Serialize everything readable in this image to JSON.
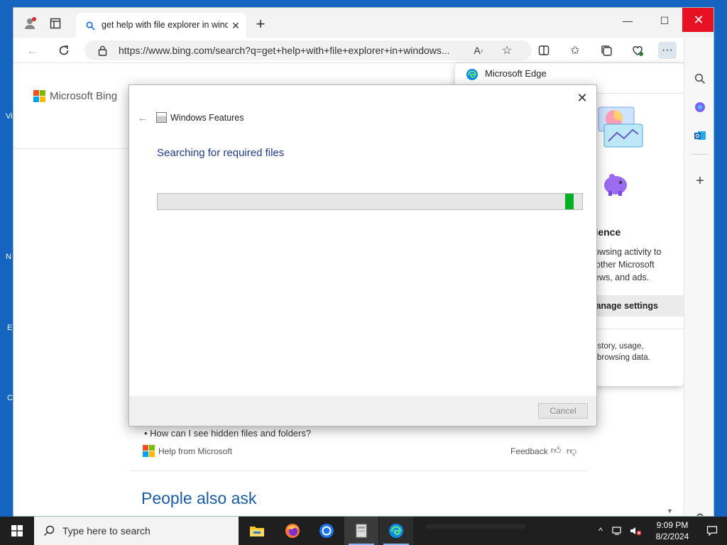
{
  "desktop": {
    "left_edge_labels": [
      "Vi",
      "N",
      "E",
      "C"
    ]
  },
  "browser": {
    "tab": {
      "title": "get help with file explorer in windows"
    },
    "address": {
      "url": "https://www.bing.com/search?q=get+help+with+file+explorer+in+windows..."
    },
    "window_controls": {
      "close": "✕",
      "minimize": "—",
      "maximize": "☐"
    }
  },
  "bing": {
    "logo_text": "Microsoft Bing",
    "below_dialog": {
      "bullet_text": "How can I see hidden files and folders?",
      "help_from": "Help from Microsoft",
      "feedback": "Feedback",
      "section_title": "People also ask"
    }
  },
  "edge_popover": {
    "header": "Microsoft Edge",
    "heading_fragment": "rience",
    "body_lines": [
      "owsing activity to",
      "other Microsoft",
      "ews, and ads."
    ],
    "manage_settings": "Manage settings",
    "footer_lines": [
      "istory, usage,",
      "browsing data."
    ]
  },
  "dialog": {
    "title": "Windows Features",
    "heading": "Searching for required files",
    "progress_fraction": 0.98,
    "cancel_label": "Cancel"
  },
  "taskbar": {
    "search_placeholder": "Type here to search",
    "time": "9:09 PM",
    "date": "8/2/2024"
  },
  "colors": {
    "accent": "#0078d4",
    "progress": "#06b025",
    "close_red": "#e81123"
  }
}
